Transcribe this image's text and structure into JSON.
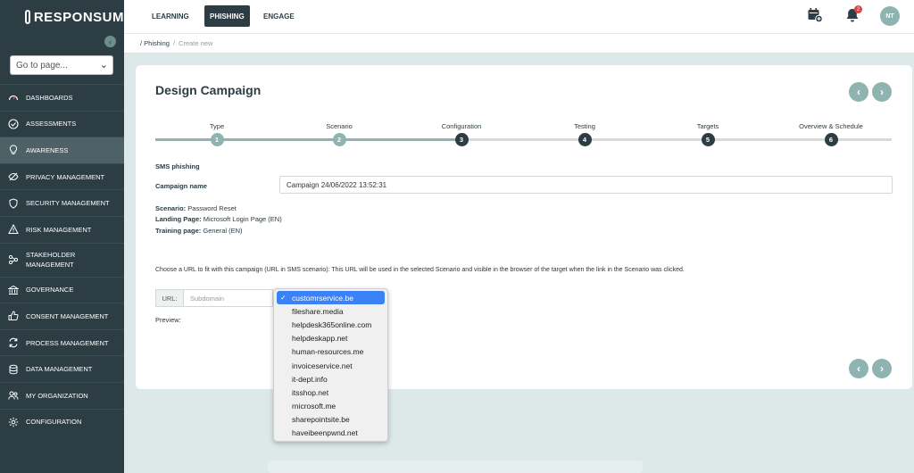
{
  "brand": {
    "name": "RESPONSUM"
  },
  "sidebar": {
    "goto_placeholder": "Go to page...",
    "items": [
      {
        "label": "DASHBOARDS",
        "icon": "gauge-icon"
      },
      {
        "label": "ASSESSMENTS",
        "icon": "check-circle-icon"
      },
      {
        "label": "AWARENESS",
        "icon": "lightbulb-icon"
      },
      {
        "label": "PRIVACY MANAGEMENT",
        "icon": "eye-off-icon"
      },
      {
        "label": "SECURITY MANAGEMENT",
        "icon": "shield-icon"
      },
      {
        "label": "RISK MANAGEMENT",
        "icon": "warning-icon"
      },
      {
        "label": "STAKEHOLDER MANAGEMENT",
        "icon": "network-icon"
      },
      {
        "label": "GOVERNANCE",
        "icon": "building-icon"
      },
      {
        "label": "CONSENT MANAGEMENT",
        "icon": "thumbs-up-icon"
      },
      {
        "label": "PROCESS MANAGEMENT",
        "icon": "refresh-icon"
      },
      {
        "label": "DATA MANAGEMENT",
        "icon": "database-icon"
      },
      {
        "label": "MY ORGANIZATION",
        "icon": "users-icon"
      },
      {
        "label": "CONFIGURATION",
        "icon": "gear-icon"
      }
    ]
  },
  "topbar": {
    "tabs": [
      {
        "label": "LEARNING"
      },
      {
        "label": "PHISHING"
      },
      {
        "label": "ENGAGE"
      }
    ],
    "notification_count": "2",
    "avatar_initials": "NT"
  },
  "breadcrumb": {
    "parent": "Phishing",
    "current": "Create new"
  },
  "campaign": {
    "title": "Design Campaign",
    "steps": [
      {
        "label": "Type",
        "number": "1"
      },
      {
        "label": "Scenario",
        "number": "2"
      },
      {
        "label": "Configuration",
        "number": "3"
      },
      {
        "label": "Testing",
        "number": "4"
      },
      {
        "label": "Targets",
        "number": "5"
      },
      {
        "label": "Overview & Schedule",
        "number": "6"
      }
    ],
    "section": "SMS phishing",
    "name_label": "Campaign name",
    "name_value": "Campaign 24/06/2022 13:52:31",
    "scenario_label": "Scenario:",
    "scenario_value": "Password Reset",
    "landing_label": "Landing Page:",
    "landing_value": "Microsoft Login Page (EN)",
    "training_label": "Training page:",
    "training_value": "General (EN)",
    "url_description": "Choose a URL to fit with this campaign (URL in SMS scenario): This URL will be used in the selected Scenario and visible in the browser of the target when the link in the Scenario was clicked.",
    "url_prefix": "URL:",
    "subdomain_placeholder": "Subdomain",
    "preview_label": "Preview:"
  },
  "domain_options": [
    "customrservice.be",
    "fileshare.media",
    "helpdesk365online.com",
    "helpdeskapp.net",
    "human-resources.me",
    "invoiceservice.net",
    "it-dept.info",
    "itsshop.net",
    "rnicrosoft.me",
    "sharepointsite.be",
    "haveibeenpwnd.net"
  ],
  "selected_domain": "customrservice.be",
  "colors": {
    "sidebar": "#2c3d43",
    "accent": "#8fb3b0",
    "select_highlight": "#3b82f6"
  }
}
